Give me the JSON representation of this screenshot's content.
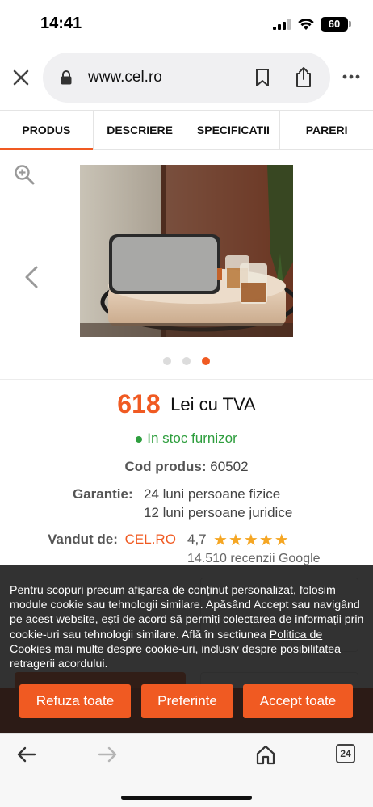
{
  "status_bar": {
    "time": "14:41",
    "battery": "60"
  },
  "browser": {
    "url": "www.cel.ro",
    "open_tabs": "24"
  },
  "tabs": [
    "PRODUS",
    "DESCRIERE",
    "SPECIFICATII",
    "PARERI"
  ],
  "active_tab": 0,
  "gallery": {
    "image_count": 3,
    "active_index": 2
  },
  "product": {
    "price": "618",
    "price_label": "Lei cu TVA",
    "stock": "In stoc furnizor",
    "code_label": "Cod produs:",
    "code_value": "60502",
    "warranty_label": "Garantie:",
    "warranty_line1": "24 luni persoane fizice",
    "warranty_line2": "12 luni persoane juridice",
    "seller_label": "Vandut de:",
    "seller_name": "CEL.RO",
    "rating": "4,7",
    "stars": 5,
    "reviews": "14.510 recenzii Google"
  },
  "cookie": {
    "text_before_link": "Pentru scopuri precum afișarea de conținut personalizat, folosim module cookie sau tehnologii similare. Apăsând Accept sau navigând pe acest website, ești de acord să permiți colectarea de informații prin cookie-uri sau tehnologii similare. Află în sectiunea ",
    "link_text": "Politica de Cookies",
    "text_after_link": " mai multe despre cookie-uri, inclusiv despre posibilitatea retragerii acordului.",
    "refuse_label": "Refuza toate",
    "prefs_label": "Preferinte",
    "accept_label": "Accept toate"
  },
  "colors": {
    "accent": "#f05a22",
    "stock_green": "#2e9e3e",
    "star": "#f5a623"
  }
}
